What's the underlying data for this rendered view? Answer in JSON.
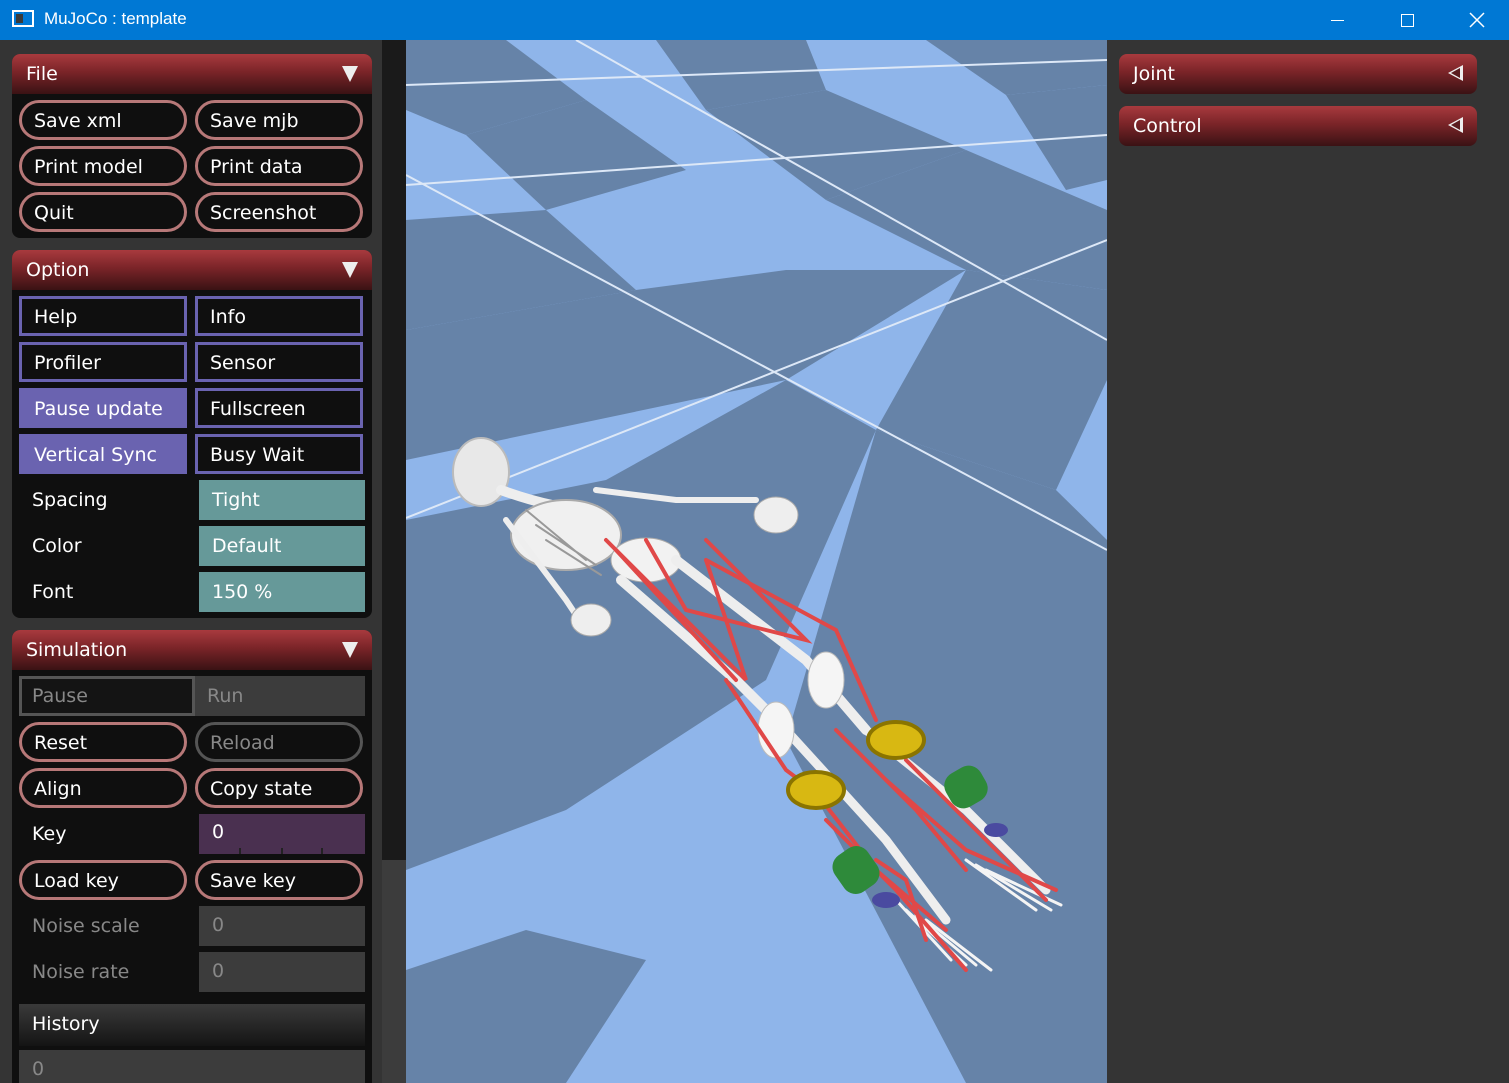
{
  "window": {
    "title": "MuJoCo : template"
  },
  "file": {
    "header": "File",
    "buttons": [
      "Save xml",
      "Save mjb",
      "Print model",
      "Print data",
      "Quit",
      "Screenshot"
    ]
  },
  "option": {
    "header": "Option",
    "toggles": [
      {
        "label": "Help",
        "on": false
      },
      {
        "label": "Info",
        "on": false
      },
      {
        "label": "Profiler",
        "on": false
      },
      {
        "label": "Sensor",
        "on": false
      },
      {
        "label": "Pause update",
        "on": true
      },
      {
        "label": "Fullscreen",
        "on": false
      },
      {
        "label": "Vertical Sync",
        "on": true
      },
      {
        "label": "Busy Wait",
        "on": false
      }
    ],
    "spacing_label": "Spacing",
    "spacing_value": "Tight",
    "color_label": "Color",
    "color_value": "Default",
    "font_label": "Font",
    "font_value": "150 %"
  },
  "simulation": {
    "header": "Simulation",
    "pause": "Pause",
    "run": "Run",
    "reset": "Reset",
    "reload": "Reload",
    "align": "Align",
    "copy_state": "Copy state",
    "key_label": "Key",
    "key_value": "0",
    "load_key": "Load key",
    "save_key": "Save key",
    "noise_scale_label": "Noise scale",
    "noise_scale_value": "0",
    "noise_rate_label": "Noise rate",
    "noise_rate_value": "0",
    "history_label": "History",
    "history_value": "0"
  },
  "right": {
    "joint": "Joint",
    "control": "Control"
  },
  "colors": {
    "titlebar": "#0078d4",
    "header_red": "#7a2428",
    "toggle_on": "#6a63b0",
    "select_teal": "#669999",
    "floor_light": "#8fb5ea",
    "floor_dark": "#6683a8"
  }
}
